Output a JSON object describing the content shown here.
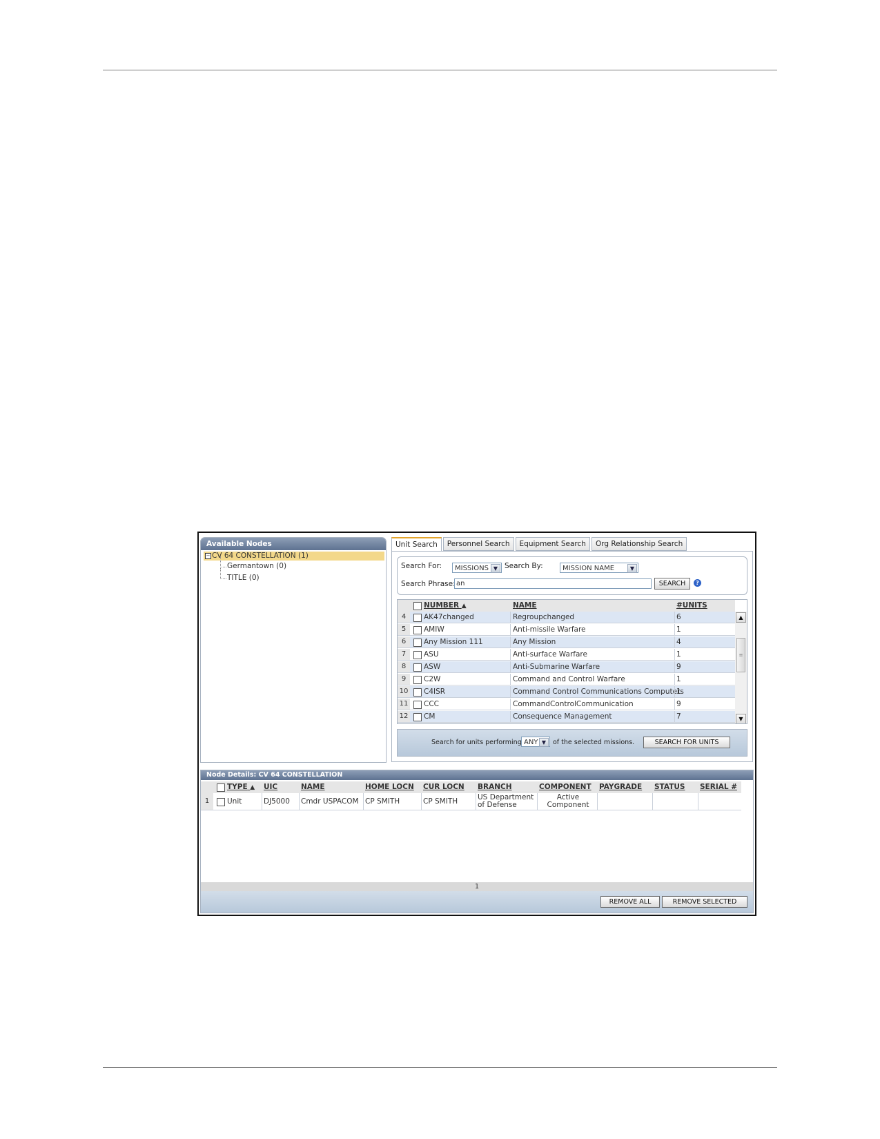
{
  "nodes": {
    "title": "Available Nodes",
    "root": "CV 64 CONSTELLATION (1)",
    "expander": "−",
    "children": [
      "Germantown (0)",
      "TITLE (0)"
    ]
  },
  "tabs": [
    "Unit Search",
    "Personnel Search",
    "Equipment Search",
    "Org Relationship Search"
  ],
  "search": {
    "for_label": "Search For:",
    "for_value": "MISSIONS",
    "by_label": "Search By:",
    "by_value": "MISSION NAME",
    "phrase_label": "Search Phrase:",
    "phrase_value": "an",
    "search_button": "SEARCH",
    "help_icon": "?"
  },
  "grid": {
    "headers": {
      "number": "NUMBER",
      "sort_indicator": "▲",
      "name": "NAME",
      "units": "#UNITS"
    },
    "rows": [
      {
        "n": "4",
        "number": "AK47changed",
        "name": "Regroupchanged",
        "units": "6"
      },
      {
        "n": "5",
        "number": "AMIW",
        "name": "Anti-missile Warfare",
        "units": "1"
      },
      {
        "n": "6",
        "number": "Any Mission 111",
        "name": "Any Mission",
        "units": "4"
      },
      {
        "n": "7",
        "number": "ASU",
        "name": "Anti-surface Warfare",
        "units": "1"
      },
      {
        "n": "8",
        "number": "ASW",
        "name": "Anti-Submarine Warfare",
        "units": "9"
      },
      {
        "n": "9",
        "number": "C2W",
        "name": "Command and Control Warfare",
        "units": "1"
      },
      {
        "n": "10",
        "number": "C4ISR",
        "name": "Command Control Communications Computers",
        "units": "1"
      },
      {
        "n": "11",
        "number": "CCC",
        "name": "CommandControlCommunication",
        "units": "9"
      },
      {
        "n": "12",
        "number": "CM",
        "name": "Consequence Management",
        "units": "7"
      }
    ],
    "scroll_up": "▲",
    "scroll_down": "▼",
    "thumb_grip": "≡"
  },
  "units_search": {
    "prefix": "Search for units performing",
    "mode": "ANY",
    "suffix": "of the selected missions.",
    "button": "SEARCH FOR UNITS"
  },
  "details": {
    "title": "Node Details: CV 64 CONSTELLATION",
    "headers": {
      "type": "TYPE",
      "sort_indicator": "▲",
      "uic": "UIC",
      "name": "NAME",
      "home": "HOME LOCN",
      "cur": "CUR LOCN",
      "branch": "BRANCH",
      "component": "COMPONENT",
      "paygrade": "PAYGRADE",
      "status": "STATUS",
      "serial": "SERIAL #"
    },
    "row": {
      "n": "1",
      "type": "Unit",
      "uic": "DJ5000",
      "name": "Cmdr USPACOM",
      "home": "CP SMITH",
      "cur": "CP SMITH",
      "branch_1": "US Department",
      "branch_2": "of Defense",
      "component_1": "Active",
      "component_2": "Component"
    },
    "page": "1",
    "remove_all": "REMOVE ALL",
    "remove_selected": "REMOVE SELECTED"
  }
}
